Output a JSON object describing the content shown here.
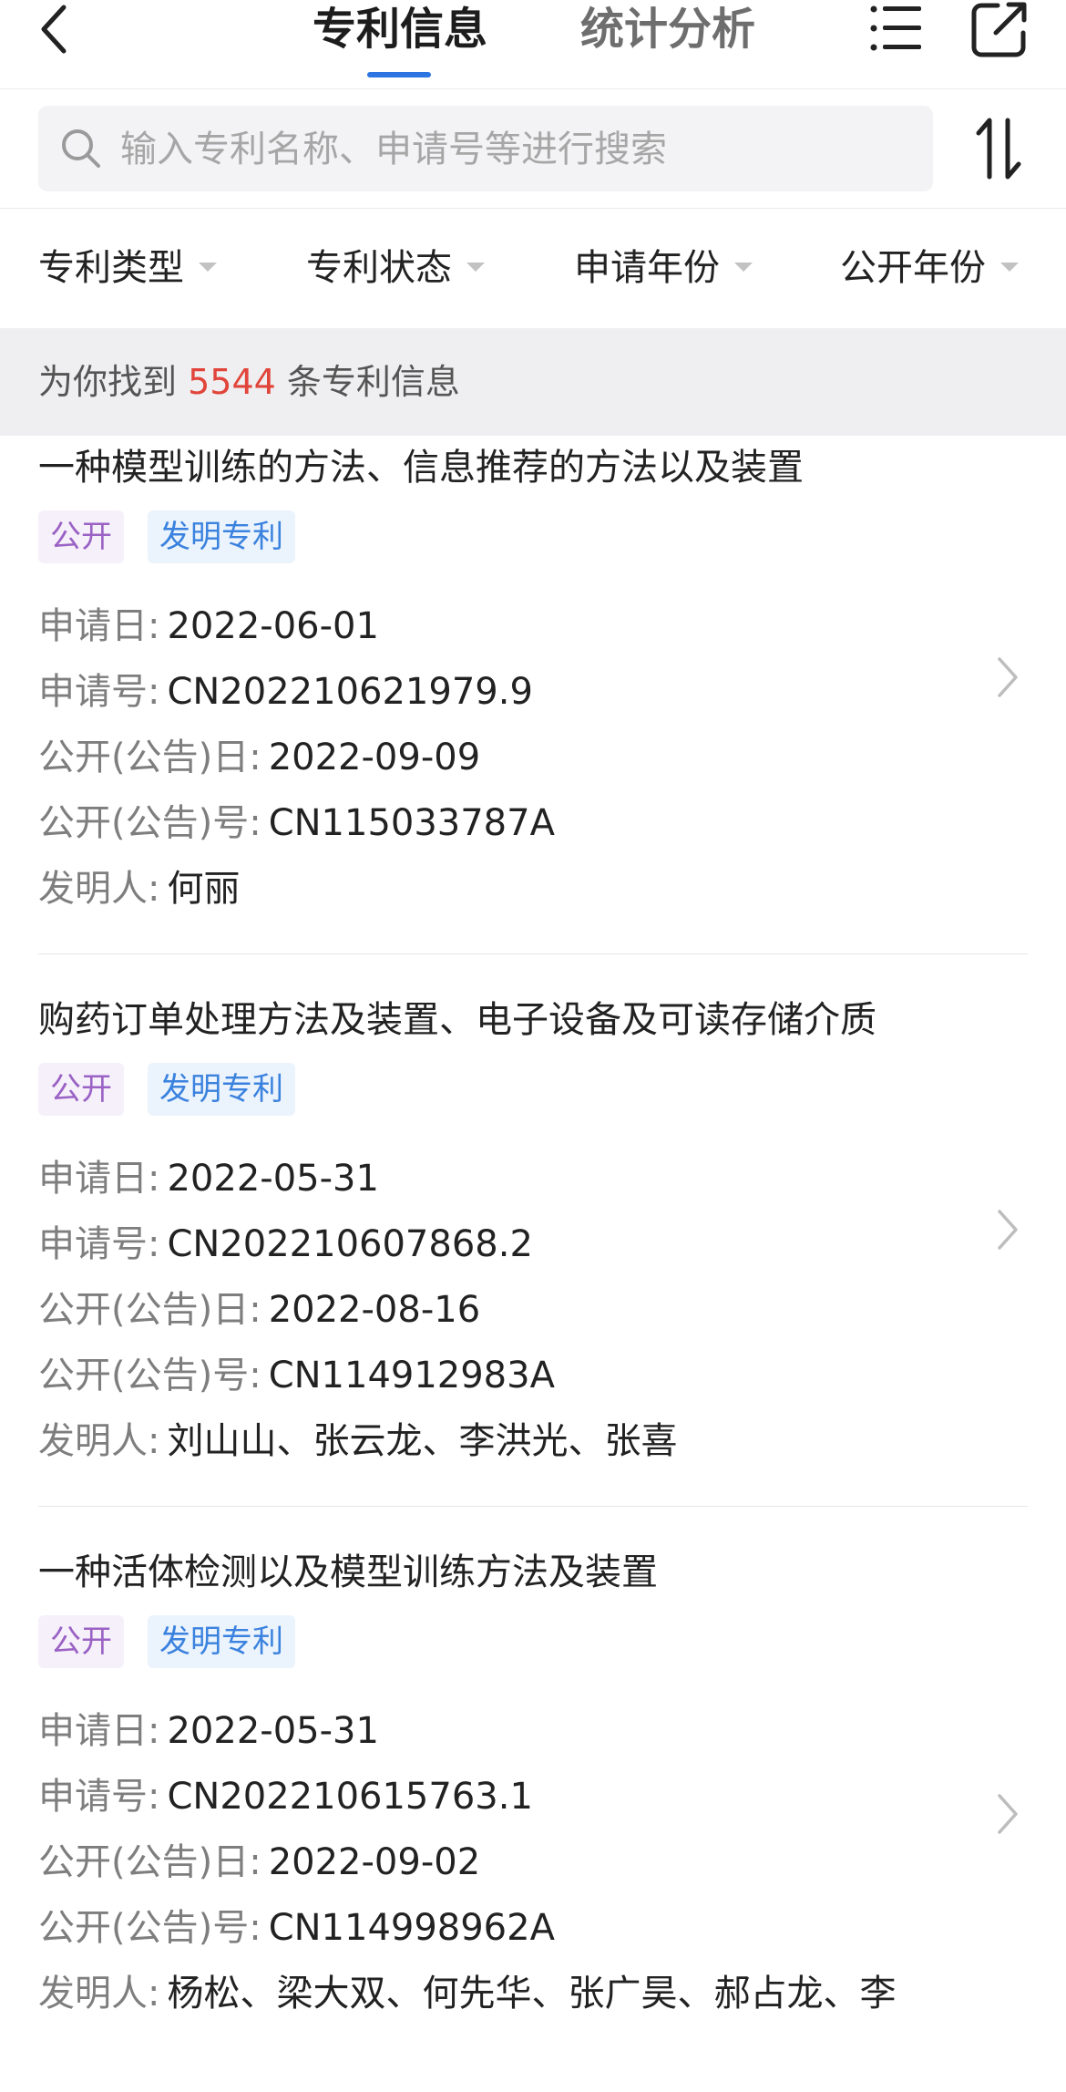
{
  "header": {
    "tabs": [
      {
        "label": "专利信息",
        "active": true
      },
      {
        "label": "统计分析",
        "active": false
      }
    ],
    "accent_color": "#2b74e2",
    "icons": {
      "back": "chevron-left-icon",
      "menu": "list-icon",
      "share": "share-icon"
    }
  },
  "search": {
    "placeholder": "输入专利名称、申请号等进行搜索",
    "value": "",
    "sort_icon": "sort-icon"
  },
  "filters": [
    {
      "label": "专利类型"
    },
    {
      "label": "专利状态"
    },
    {
      "label": "申请年份"
    },
    {
      "label": "公开年份"
    }
  ],
  "result": {
    "prefix": "为你找到",
    "count": "5544",
    "suffix": "条专利信息",
    "count_color": "#e1443a"
  },
  "field_labels": {
    "apply_date": "申请日:",
    "apply_no": "申请号:",
    "pub_date": "公开(公告)日:",
    "pub_no": "公开(公告)号:",
    "inventor": "发明人:"
  },
  "patents": [
    {
      "title": "一种模型训练的方法、信息推荐的方法以及装置",
      "status_tag": "公开",
      "type_tag": "发明专利",
      "apply_date": "2022-06-01",
      "apply_no": "CN202210621979.9",
      "pub_date": "2022-09-09",
      "pub_no": "CN115033787A",
      "inventor": "何丽"
    },
    {
      "title": "购药订单处理方法及装置、电子设备及可读存储介质",
      "status_tag": "公开",
      "type_tag": "发明专利",
      "apply_date": "2022-05-31",
      "apply_no": "CN202210607868.2",
      "pub_date": "2022-08-16",
      "pub_no": "CN114912983A",
      "inventor": "刘山山、张云龙、李洪光、张喜"
    },
    {
      "title": "一种活体检测以及模型训练方法及装置",
      "status_tag": "公开",
      "type_tag": "发明专利",
      "apply_date": "2022-05-31",
      "apply_no": "CN202210615763.1",
      "pub_date": "2022-09-02",
      "pub_no": "CN114998962A",
      "inventor": "杨松、梁大双、何先华、张广昊、郝占龙、李"
    }
  ]
}
